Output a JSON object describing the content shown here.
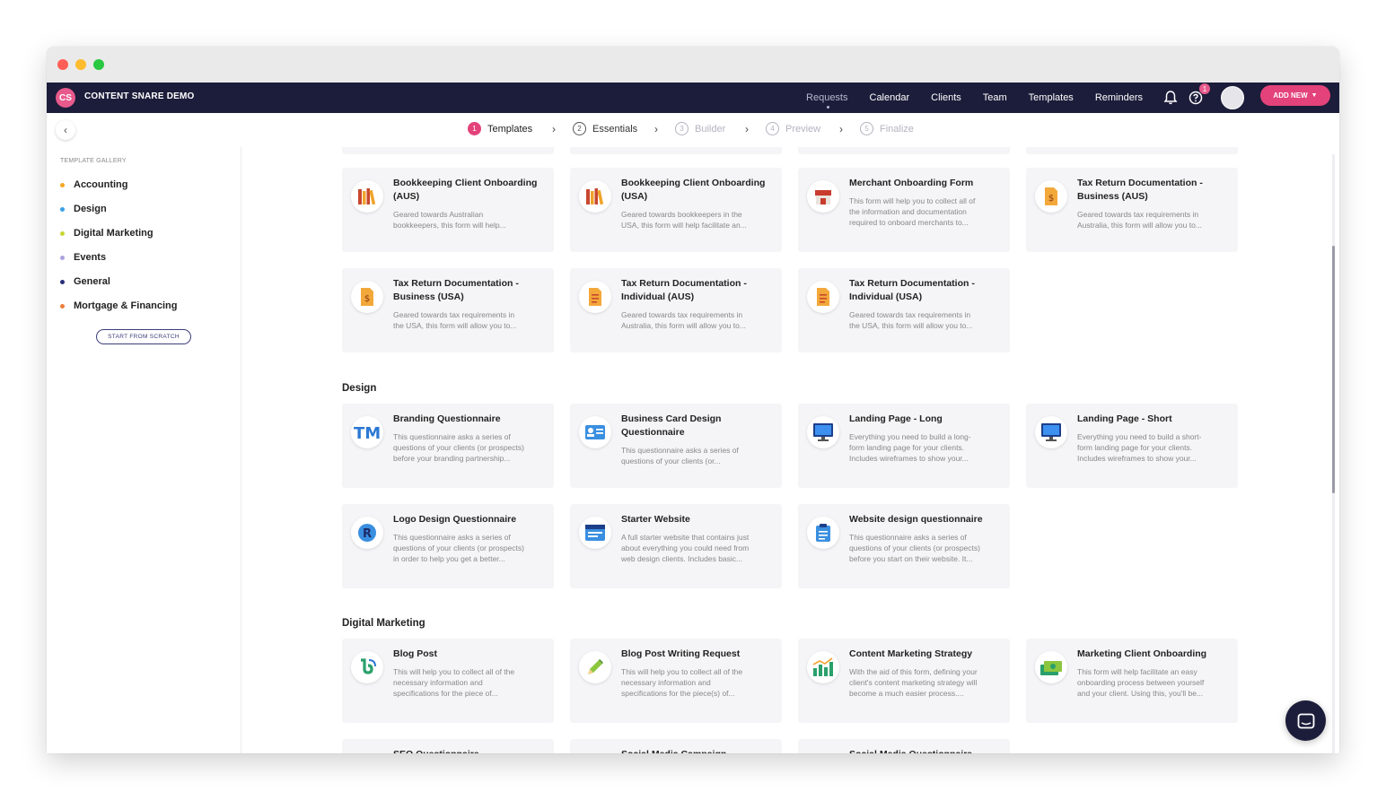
{
  "window": {
    "traffic_lights": {
      "close": "#ff5f57",
      "minimize": "#febc2e",
      "zoom": "#28c840"
    }
  },
  "topnav": {
    "logo": "CS",
    "app_name": "CONTENT SNARE DEMO",
    "links": [
      "Requests",
      "Calendar",
      "Clients",
      "Team",
      "Templates",
      "Reminders"
    ],
    "help_badge": "1",
    "add_new": "ADD NEW"
  },
  "steps": [
    {
      "num": "1",
      "label": "Templates"
    },
    {
      "num": "2",
      "label": "Essentials"
    },
    {
      "num": "3",
      "label": "Builder"
    },
    {
      "num": "4",
      "label": "Preview"
    },
    {
      "num": "5",
      "label": "Finalize"
    }
  ],
  "sidebar": {
    "title": "TEMPLATE GALLERY",
    "categories": [
      {
        "label": "Accounting",
        "color": "#f5a623"
      },
      {
        "label": "Design",
        "color": "#3aa0e8"
      },
      {
        "label": "Digital Marketing",
        "color": "#c8d632"
      },
      {
        "label": "Events",
        "color": "#a9a3dc"
      },
      {
        "label": "General",
        "color": "#2a2f7a"
      },
      {
        "label": "Mortgage & Financing",
        "color": "#ee7f3a"
      }
    ],
    "start_from_scratch": "START FROM SCRATCH"
  },
  "sections": {
    "accounting": {
      "cards": [
        {
          "title": "Bookkeeping Client Onboarding (AUS)",
          "desc": [
            "Geared towards Australian",
            "bookkeepers, this form will help..."
          ],
          "icon": "books-icon"
        },
        {
          "title": "Bookkeeping Client Onboarding (USA)",
          "desc": [
            "Geared towards bookkeepers in the",
            "USA, this form will help facilitate an..."
          ],
          "icon": "books-icon"
        },
        {
          "title": "Merchant Onboarding Form",
          "desc": [
            "This form will help you to collect all of",
            "the information and documentation",
            "required to onboard merchants to..."
          ],
          "icon": "store-icon"
        },
        {
          "title": "Tax Return Documentation - Business (AUS)",
          "desc": [
            "Geared towards tax requirements in",
            "Australia, this form will allow you to..."
          ],
          "icon": "tax-document-icon"
        },
        {
          "title": "Tax Return Documentation - Business (USA)",
          "desc": [
            "Geared towards tax requirements in",
            "the USA, this form will allow you to..."
          ],
          "icon": "tax-document-icon"
        },
        {
          "title": "Tax Return Documentation - Individual (AUS)",
          "desc": [
            "Geared towards tax requirements in",
            "Australia, this form will allow you to..."
          ],
          "icon": "document-icon"
        },
        {
          "title": "Tax Return Documentation - Individual (USA)",
          "desc": [
            "Geared towards tax requirements in",
            "the USA, this form will allow you to..."
          ],
          "icon": "document-icon"
        }
      ]
    },
    "design": {
      "title": "Design",
      "cards": [
        {
          "title": "Branding Questionnaire",
          "desc": [
            "This questionnaire asks a series of",
            "questions of your clients (or prospects)",
            "before your branding partnership..."
          ],
          "icon": "trademark-icon"
        },
        {
          "title": "Business Card Design Questionnaire",
          "desc": [
            "This questionnaire asks a series of",
            "questions of your clients (or..."
          ],
          "icon": "id-card-icon"
        },
        {
          "title": "Landing Page - Long",
          "desc": [
            "Everything you need to build a long-",
            "form landing page for your clients.",
            "Includes wireframes to show your..."
          ],
          "icon": "monitor-icon"
        },
        {
          "title": "Landing Page - Short",
          "desc": [
            "Everything you need to build a short-",
            "form landing page for your clients.",
            "Includes wireframes to show your..."
          ],
          "icon": "monitor-icon"
        },
        {
          "title": "Logo Design Questionnaire",
          "desc": [
            "This questionnaire asks a series of",
            "questions of your clients (or prospects)",
            "in order to help you get a better..."
          ],
          "icon": "registered-icon"
        },
        {
          "title": "Starter Website",
          "desc": [
            "A full starter website that contains just",
            "about everything you could need from",
            "web design clients. Includes basic..."
          ],
          "icon": "browser-window-icon"
        },
        {
          "title": "Website design questionnaire",
          "desc": [
            "This questionnaire asks a series of",
            "questions of your clients (or prospects)",
            "before you start on their website. It..."
          ],
          "icon": "clipboard-icon"
        }
      ]
    },
    "digital_marketing": {
      "title": "Digital Marketing",
      "cards": [
        {
          "title": "Blog Post",
          "desc": [
            "This will help you to collect all of the",
            "necessary information and",
            "specifications for the piece of..."
          ],
          "icon": "blog-icon"
        },
        {
          "title": "Blog Post Writing Request",
          "desc": [
            "This will help you to collect all of the",
            "necessary information and",
            "specifications for the piece(s) of..."
          ],
          "icon": "pencil-icon"
        },
        {
          "title": "Content Marketing Strategy",
          "desc": [
            "With the aid of this form, defining your",
            "client's content marketing strategy will",
            "become a much easier process...."
          ],
          "icon": "bar-chart-icon"
        },
        {
          "title": "Marketing Client Onboarding",
          "desc": [
            "This form will help facilitate an easy",
            "onboarding process between yourself",
            "and your client. Using this, you'll be..."
          ],
          "icon": "money-icon"
        },
        {
          "title": "SEO Questionnaire",
          "desc": [],
          "icon": ""
        },
        {
          "title": "Social Media Campaign",
          "desc": [],
          "icon": ""
        },
        {
          "title": "Social Media Questionnaire",
          "desc": [],
          "icon": ""
        }
      ]
    }
  }
}
